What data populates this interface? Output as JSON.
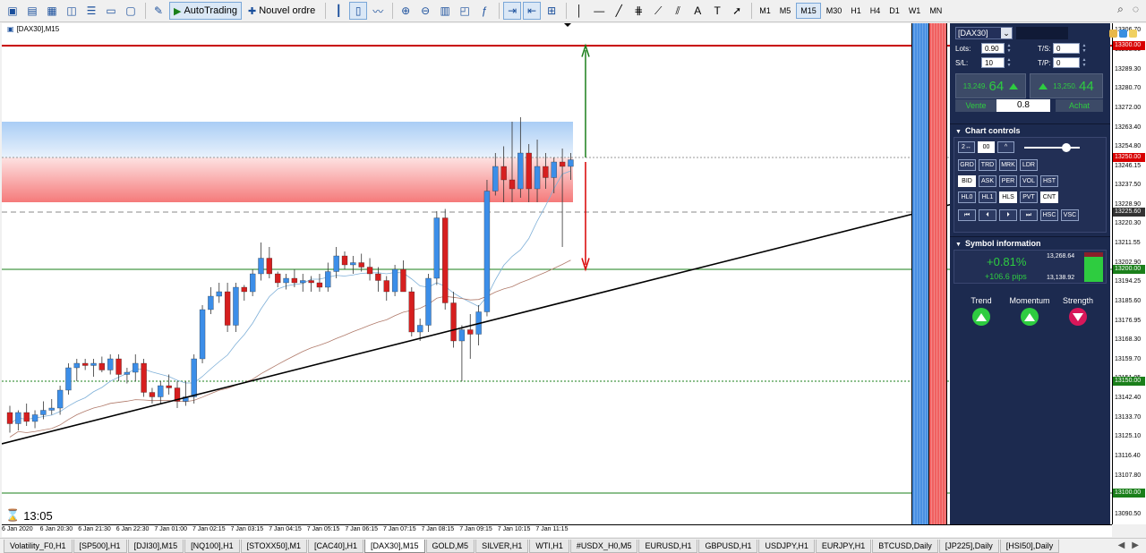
{
  "toolbar": {
    "autotrading_label": "AutoTrading",
    "new_order_label": "Nouvel ordre",
    "timeframes": [
      "M1",
      "M5",
      "M15",
      "M30",
      "H1",
      "H4",
      "D1",
      "W1",
      "MN"
    ],
    "active_timeframe": "M15"
  },
  "chart": {
    "title": "[DAX30],M15",
    "clock": "13:05",
    "price_min": 13086,
    "price_max": 13310,
    "price_labels": [
      "13306.70",
      "13298.00",
      "13289.30",
      "13280.70",
      "13272.00",
      "13263.40",
      "13254.80",
      "13246.15",
      "13237.50",
      "13228.90",
      "13220.30",
      "13211.55",
      "13202.90",
      "13194.25",
      "13185.60",
      "13176.95",
      "13168.30",
      "13159.70",
      "13151.05",
      "13142.40",
      "13133.70",
      "13125.10",
      "13116.40",
      "13107.80",
      "13099.15",
      "13090.50"
    ],
    "level_labels": [
      {
        "price": 13300.0,
        "text": "13300.00",
        "color": "#d80000"
      },
      {
        "price": 13250.0,
        "text": "13250.00",
        "color": "#d80000"
      },
      {
        "price": 13225.6,
        "text": "13225.60",
        "color": "#333333"
      },
      {
        "price": 13200.0,
        "text": "13200.00",
        "color": "#1a7f1a"
      },
      {
        "price": 13150.0,
        "text": "13150.00",
        "color": "#1a7f1a"
      },
      {
        "price": 13100.0,
        "text": "13100.00",
        "color": "#1a7f1a"
      }
    ],
    "time_labels": [
      "6 Jan 2020",
      "6 Jan 20:30",
      "6 Jan 21:30",
      "6 Jan 22:30",
      "7 Jan 01:00",
      "7 Jan 02:15",
      "7 Jan 03:15",
      "7 Jan 04:15",
      "7 Jan 05:15",
      "7 Jan 06:15",
      "7 Jan 07:15",
      "7 Jan 08:15",
      "7 Jan 09:15",
      "7 Jan 10:15",
      "7 Jan 11:15"
    ],
    "candles": [
      [
        13136,
        13139,
        13127,
        13131
      ],
      [
        13131,
        13137,
        13128,
        13136
      ],
      [
        13136,
        13140,
        13130,
        13132
      ],
      [
        13132,
        13137,
        13129,
        13135
      ],
      [
        13135,
        13141,
        13133,
        13137
      ],
      [
        13137,
        13142,
        13135,
        13138
      ],
      [
        13138,
        13148,
        13135,
        13146
      ],
      [
        13146,
        13158,
        13144,
        13156
      ],
      [
        13156,
        13160,
        13150,
        13158
      ],
      [
        13158,
        13160,
        13155,
        13157
      ],
      [
        13157,
        13160,
        13152,
        13158
      ],
      [
        13158,
        13161,
        13154,
        13155
      ],
      [
        13155,
        13162,
        13153,
        13160
      ],
      [
        13160,
        13162,
        13150,
        13153
      ],
      [
        13153,
        13156,
        13149,
        13154
      ],
      [
        13154,
        13162,
        13150,
        13158
      ],
      [
        13158,
        13160,
        13143,
        13145
      ],
      [
        13145,
        13147,
        13140,
        13143
      ],
      [
        13143,
        13150,
        13140,
        13148
      ],
      [
        13148,
        13153,
        13144,
        13147
      ],
      [
        13147,
        13150,
        13138,
        13141
      ],
      [
        13141,
        13150,
        13139,
        13143
      ],
      [
        13143,
        13162,
        13140,
        13160
      ],
      [
        13160,
        13184,
        13158,
        13182
      ],
      [
        13182,
        13192,
        13180,
        13188
      ],
      [
        13188,
        13194,
        13185,
        13190
      ],
      [
        13190,
        13194,
        13172,
        13175
      ],
      [
        13175,
        13194,
        13172,
        13192
      ],
      [
        13192,
        13193,
        13186,
        13190
      ],
      [
        13190,
        13200,
        13188,
        13198
      ],
      [
        13198,
        13212,
        13195,
        13205
      ],
      [
        13205,
        13210,
        13196,
        13198
      ],
      [
        13198,
        13199,
        13192,
        13194
      ],
      [
        13194,
        13198,
        13191,
        13196
      ],
      [
        13196,
        13200,
        13192,
        13194
      ],
      [
        13194,
        13198,
        13190,
        13195
      ],
      [
        13195,
        13197,
        13190,
        13194
      ],
      [
        13194,
        13198,
        13190,
        13192
      ],
      [
        13192,
        13203,
        13190,
        13199
      ],
      [
        13199,
        13210,
        13196,
        13206
      ],
      [
        13206,
        13208,
        13200,
        13202
      ],
      [
        13202,
        13206,
        13198,
        13203
      ],
      [
        13203,
        13207,
        13199,
        13201
      ],
      [
        13201,
        13205,
        13195,
        13198
      ],
      [
        13198,
        13201,
        13190,
        13195
      ],
      [
        13195,
        13197,
        13186,
        13190
      ],
      [
        13190,
        13202,
        13188,
        13200
      ],
      [
        13200,
        13204,
        13190,
        13190
      ],
      [
        13190,
        13192,
        13170,
        13172
      ],
      [
        13172,
        13178,
        13168,
        13175
      ],
      [
        13175,
        13198,
        13172,
        13196
      ],
      [
        13196,
        13226,
        13193,
        13223
      ],
      [
        13223,
        13227,
        13182,
        13185
      ],
      [
        13185,
        13190,
        13165,
        13168
      ],
      [
        13168,
        13175,
        13150,
        13173
      ],
      [
        13173,
        13180,
        13160,
        13171
      ],
      [
        13171,
        13184,
        13166,
        13181
      ],
      [
        13181,
        13240,
        13179,
        13235
      ],
      [
        13235,
        13252,
        13233,
        13246
      ],
      [
        13246,
        13255,
        13230,
        13240
      ],
      [
        13240,
        13266,
        13230,
        13236
      ],
      [
        13236,
        13268,
        13232,
        13252
      ],
      [
        13252,
        13256,
        13230,
        13236
      ],
      [
        13236,
        13258,
        13230,
        13246
      ],
      [
        13246,
        13252,
        13236,
        13241
      ],
      [
        13241,
        13250,
        13234,
        13248
      ],
      [
        13248,
        13254,
        13210,
        13246
      ],
      [
        13246,
        13252,
        13240,
        13249
      ]
    ]
  },
  "panel": {
    "symbol": "[DAX30]",
    "lots_label": "Lots:",
    "lots_value": "0.90",
    "sl_label": "S/L:",
    "sl_value": "10",
    "ts_label": "T/S:",
    "ts_value": "0",
    "tp_label": "T/P:",
    "tp_value": "0",
    "sell_small": "13,249.",
    "sell_big": "64",
    "buy_small": "13,250.",
    "buy_big": "44",
    "sell_label": "Vente",
    "buy_label": "Achat",
    "spread": "0.8",
    "chart_controls_title": "Chart controls",
    "chart_controls": {
      "row1": [
        "2↔",
        "00",
        "^"
      ],
      "row2": [
        "GRD",
        "TRD",
        "MRK",
        "LDR"
      ],
      "row3": [
        "BID",
        "ASK",
        "PER",
        "VOL",
        "HST"
      ],
      "row4": [
        "HL0",
        "HL1",
        "HLS",
        "PVT",
        "CNT"
      ],
      "row5": [
        "⏮",
        "⏴",
        "⏵",
        "⏭",
        "HSC",
        "VSC"
      ]
    },
    "symbol_info_title": "Symbol information",
    "change_pct": "+0.81%",
    "change_pips": "+106.6 pips",
    "day_high": "13,268.64",
    "day_low": "13,138.92",
    "day_position": 0.85,
    "indicators": [
      {
        "label": "Trend",
        "direction": "up",
        "color": "#2ecc40"
      },
      {
        "label": "Momentum",
        "direction": "up",
        "color": "#2ecc40"
      },
      {
        "label": "Strength",
        "direction": "down",
        "color": "#d8175a"
      }
    ]
  },
  "tabs": [
    "Volatility_F0,H1",
    "[SP500],H1",
    "[DJI30],M15",
    "[NQ100],H1",
    "[STOXX50],M1",
    "[CAC40],H1",
    "[DAX30],M15",
    "GOLD,M5",
    "SILVER,H1",
    "WTI,H1",
    "#USDX_H0,M5",
    "EURUSD,H1",
    "GBPUSD,H1",
    "USDJPY,H1",
    "EURJPY,H1",
    "BTCUSD,Daily",
    "[JP225],Daily",
    "[HSI50],Daily"
  ],
  "active_tab": "[DAX30],M15",
  "colors": {
    "bull": "#3c8ee8",
    "bear": "#d61f1f",
    "panel_bg": "#1c2a4f",
    "accent_green": "#2ecc40"
  }
}
